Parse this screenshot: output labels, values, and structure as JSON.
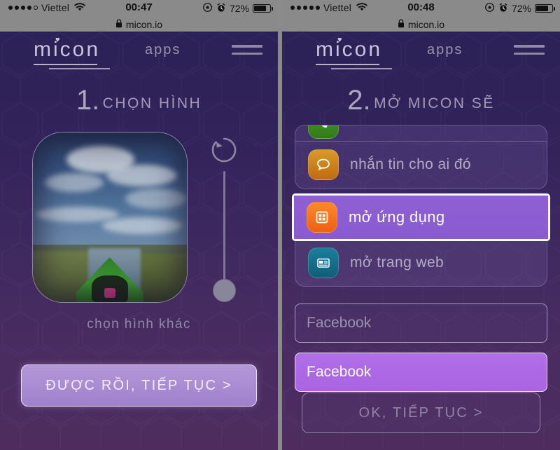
{
  "left": {
    "status": {
      "signal_dots_filled": 4,
      "signal_dots_total": 5,
      "carrier": "Viettel",
      "wifi_icon": "wifi-icon",
      "time": "00:47",
      "lock_rotation_icon": "rotation-lock-icon",
      "alarm_icon": "alarm-icon",
      "battery_percent": "72%",
      "lock_icon": "lock-icon",
      "url": "micon.io"
    },
    "header": {
      "logo": "micon",
      "heart_icon": "heart-icon",
      "apps_label": "apps",
      "menu_icon": "hamburger-menu-icon"
    },
    "step": {
      "number": "1.",
      "label": "CHỌN HÌNH"
    },
    "photo": {
      "alt_link": "chọn hình khác",
      "image_name": "kayak-on-water-photo"
    },
    "controls": {
      "rotate_icon": "rotate-counterclockwise-icon",
      "slider_name": "zoom-slider"
    },
    "cta": {
      "label": "ĐƯỢC RỒI, TIẾP TỤC >"
    }
  },
  "right": {
    "status": {
      "signal_dots_filled": 5,
      "signal_dots_total": 5,
      "carrier": "Viettel",
      "wifi_icon": "wifi-icon",
      "time": "00:48",
      "lock_rotation_icon": "rotation-lock-icon",
      "alarm_icon": "alarm-icon",
      "battery_percent": "72%",
      "lock_icon": "lock-icon",
      "url": "micon.io"
    },
    "header": {
      "logo": "micon",
      "heart_icon": "heart-icon",
      "apps_label": "apps",
      "menu_icon": "hamburger-menu-icon"
    },
    "step": {
      "number": "2.",
      "label": "MỞ MICON SẼ"
    },
    "actions": [
      {
        "label": "",
        "icon": "phone-call-icon",
        "icon_color": "#3f8a22",
        "selected": false,
        "clipped": true
      },
      {
        "label": "nhắn tin cho ai đó",
        "icon": "message-bubble-icon",
        "icon_color": "#d88a1e",
        "selected": false,
        "clipped": false
      },
      {
        "label": "mở ứng dụng",
        "icon": "app-grid-icon",
        "icon_color": "#f2701d",
        "selected": true,
        "clipped": false
      },
      {
        "label": "mở trang web",
        "icon": "web-page-icon",
        "icon_color": "#15738f",
        "selected": false,
        "clipped": false
      }
    ],
    "target_field": {
      "value": "Facebook",
      "placeholder": "Facebook"
    },
    "suggestion": {
      "label": "Facebook"
    },
    "cta": {
      "label": "OK, TIẾP TỤC >",
      "disabled": true
    }
  },
  "colors": {
    "accent_purple": "#8f5fd4",
    "suggestion_purple": "#a964e2",
    "bg_top": "#2b2257",
    "bg_bottom": "#4e2d5e",
    "statusbar_gray": "#8a8a8a"
  }
}
